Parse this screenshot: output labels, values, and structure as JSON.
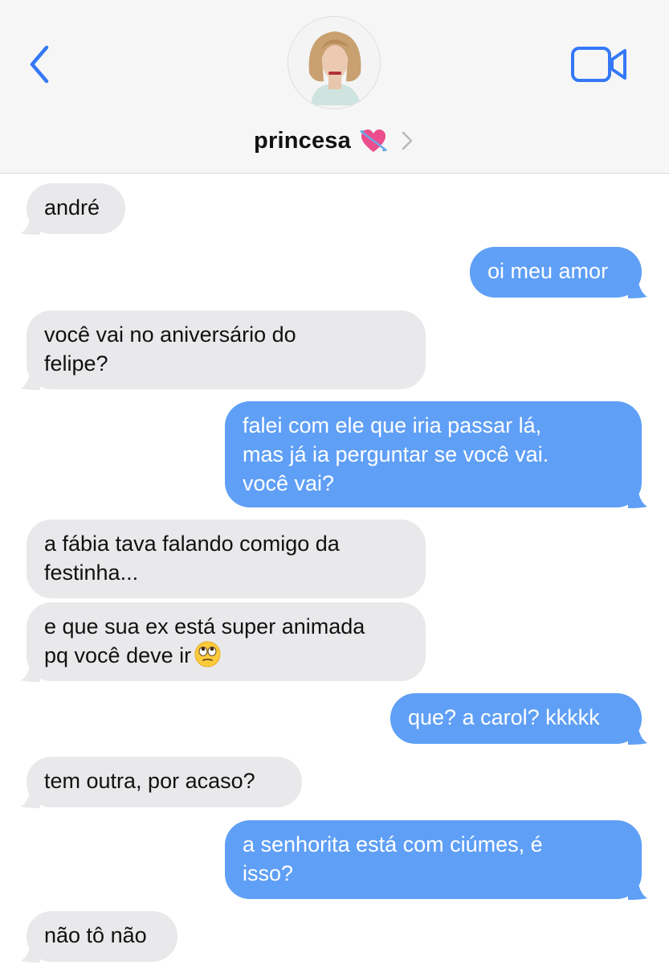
{
  "contact": {
    "name": "princesa",
    "name_emoji": "heart-with-arrow-icon"
  },
  "icons": {
    "back": "chevron-left-icon",
    "video": "video-camera-icon",
    "details": "chevron-right-icon"
  },
  "colors": {
    "accent": "#3478f6",
    "outgoing_bubble": "#5f9ff6",
    "incoming_bubble": "#e9e9eb",
    "header_bg": "#f6f6f6"
  },
  "messages": [
    {
      "dir": "in",
      "lines": [
        "andré"
      ]
    },
    {
      "dir": "out",
      "lines": [
        "oi meu amor"
      ]
    },
    {
      "dir": "in",
      "lines": [
        "você vai no aniversário do",
        "felipe?"
      ]
    },
    {
      "dir": "out",
      "lines": [
        "falei com ele que iria passar lá,",
        "mas já ia perguntar se você vai.",
        "você vai?"
      ]
    },
    {
      "dir": "in",
      "lines": [
        "a fábia tava falando comigo da",
        "festinha..."
      ]
    },
    {
      "dir": "in",
      "lines": [
        "e que sua ex está super animada",
        "pq você deve ir"
      ],
      "trailing_emoji": "face-with-rolling-eyes-icon"
    },
    {
      "dir": "out",
      "lines": [
        "que? a carol? kkkkk"
      ]
    },
    {
      "dir": "in",
      "lines": [
        "tem outra, por acaso?"
      ]
    },
    {
      "dir": "out",
      "lines": [
        "a senhorita está com ciúmes, é",
        "isso?"
      ]
    },
    {
      "dir": "in",
      "lines": [
        "não tô não"
      ]
    }
  ]
}
